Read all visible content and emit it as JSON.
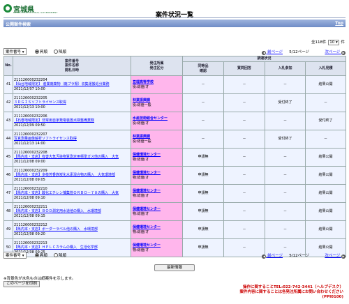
{
  "logo": {
    "name": "宮城県",
    "sub": "MIYAGI PREFECTURAL GOVERNMENT"
  },
  "header": {
    "title": "案件状況一覧",
    "bar_label": "公開案件検索",
    "top_link": "Top"
  },
  "count": {
    "total": "全118件",
    "per_page": "10",
    "unit": "件"
  },
  "sort": {
    "selected": "案件番号",
    "options": [
      {
        "label": "昇順",
        "checked": true
      },
      {
        "label": "降順",
        "checked": false
      }
    ]
  },
  "pager": {
    "prev": "前ページ",
    "position": "5/12ページ",
    "next": "次ページ"
  },
  "table": {
    "headers": {
      "no": "No.",
      "case": [
        "案件番号",
        "案件名称",
        "開札日時"
      ],
      "dept": [
        "発注所属",
        "発注区分"
      ],
      "group": "調達状況",
      "receipt": [
        "同等品",
        "確認"
      ],
      "qa": "質問回答",
      "entry": "入札参加",
      "bid": "入札見積"
    },
    "rows": [
      {
        "no": "41",
        "num": "211126000232204",
        "name": "【仙台地域限定】 産業廃棄物（廃プラ類）収集運搬処分業務",
        "date": "2021/12/07 10:00",
        "dept": "亘理高等学校",
        "kind": "役:総値/オ",
        "receipt": "－",
        "qa": "－",
        "entry": "－",
        "bid": "結果公開"
      },
      {
        "no": "42",
        "num": "211126000232205",
        "name": "３ＤＧＩＳソフトライセンス取得",
        "date": "2021/12/13 10:00",
        "dept": "林業振興課",
        "kind": "役:総値一般",
        "receipt": "－",
        "qa": "－",
        "entry": "受付終了",
        "bid": "－"
      },
      {
        "no": "43",
        "num": "211126000232206",
        "name": "【石巻地域限定】非常用自家発電装置点検整備業務",
        "date": "2021/12/09 09:50",
        "dept": "水産技術総合センター",
        "kind": "役:総値/オ",
        "receipt": "－",
        "qa": "－",
        "entry": "－",
        "bid": "受付終了"
      },
      {
        "no": "44",
        "num": "211126000232207",
        "name": "写真測量画像解析ソフトライセンス取得",
        "date": "2021/12/13 14:00",
        "dept": "林業振興課",
        "kind": "役:総値一般",
        "receipt": "－",
        "qa": "－",
        "entry": "受付終了",
        "bid": "－"
      },
      {
        "no": "45",
        "num": "211126000232208",
        "name": "【県内本・支店】有害大気汚染物質測定用標準ガス他の購入　大気",
        "date": "2021/12/08 09:00",
        "dept": "保健環境センター",
        "kind": "物:総値/オ",
        "receipt": "申請無",
        "qa": "－",
        "entry": "－",
        "bid": "結果公開"
      },
      {
        "no": "46",
        "num": "211126000232209",
        "name": "【県内本・支店】多核芳香族炭化水素混合物の購入　大気環境部",
        "date": "2021/12/08 09:05",
        "dept": "保健環境センター",
        "kind": "物:総値/オ",
        "receipt": "申請無",
        "qa": "－",
        "entry": "－",
        "bid": "結果公開"
      },
      {
        "no": "47",
        "num": "211126000232210",
        "name": "【県内本・支店】酸化エチレン捕集管ＯＲＢＯ－７８の購入　大気",
        "date": "2021/12/08 09:10",
        "dept": "保健環境センター",
        "kind": "物:総値/オ",
        "receipt": "申請無",
        "qa": "－",
        "entry": "－",
        "bid": "結果公開"
      },
      {
        "no": "48",
        "num": "211126000232211",
        "name": "【県内本・支店】ＢＯＤ測定用水道他の購入　水環境部",
        "date": "2021/12/08 09:15",
        "dept": "保健環境センター",
        "kind": "物:総値/オ",
        "receipt": "申請無",
        "qa": "－",
        "entry": "－",
        "bid": "結果公開"
      },
      {
        "no": "49",
        "num": "211126000232212",
        "name": "【県内本・支店】ボーダーラベル他の購入　水環境部",
        "date": "2021/12/08 09:20",
        "dept": "保健環境センター",
        "kind": "物:総値/オ",
        "receipt": "申請無",
        "qa": "－",
        "entry": "－",
        "bid": "結果公開"
      },
      {
        "no": "50",
        "num": "211126000232213",
        "name": "【県内本・支店】ＨＰＬＣカラムの購入　生活化学部",
        "date": "2021/12/08 09:25",
        "dept": "保健環境センター",
        "kind": "物:総値/オ",
        "receipt": "申請無",
        "qa": "－",
        "entry": "－",
        "bid": "結果公開"
      }
    ]
  },
  "footer": {
    "latest_button": "最新情報",
    "note": "※背景色が水色ものは紙案件を示します。",
    "print_button": "このページを印刷",
    "contact_1": "操作に関することTEL:022-742-3441（ヘルプデスク）",
    "contact_2": "案件内容に関することは各発注所属にお問い合わせください",
    "code": "(PPI0100)"
  },
  "colors": {
    "bar": "#7f98cf",
    "dept_cell": "#ffb6ec",
    "row_bg": "#eef3ff",
    "contact": "#cc0000",
    "logo": "#1b6e33"
  }
}
